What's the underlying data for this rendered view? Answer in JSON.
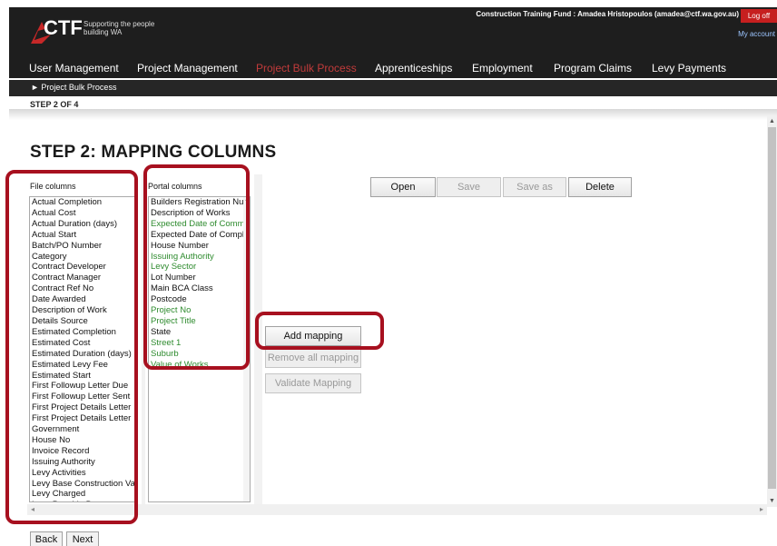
{
  "header": {
    "logo_text": "CTF",
    "tagline": "Supporting the people building WA",
    "user_line": "Construction Training Fund : Amadea Hristopoulos (amadea@ctf.wa.gov.au)",
    "logoff_label": "Log off",
    "my_account_label": "My account"
  },
  "nav": {
    "items": [
      {
        "label": "User Management"
      },
      {
        "label": "Project Management"
      },
      {
        "label": "Project Bulk Process",
        "active": true
      },
      {
        "label": "Apprenticeships"
      },
      {
        "label": "Employment"
      },
      {
        "label": "Program Claims"
      },
      {
        "label": "Levy Payments"
      }
    ]
  },
  "breadcrumb": "► Project Bulk Process",
  "step_indicator": "STEP 2 OF 4",
  "page_title": "STEP 2: MAPPING COLUMNS",
  "file_columns": {
    "label": "File columns",
    "items": [
      "Actual Completion",
      "Actual Cost",
      "Actual Duration (days)",
      "Actual Start",
      "Batch/PO Number",
      "Category",
      "Contract Developer",
      "Contract Manager",
      "Contract Ref No",
      "Date Awarded",
      "Description of Work",
      "Details Source",
      "Estimated Completion",
      "Estimated Cost",
      "Estimated Duration (days)",
      "Estimated Levy Fee",
      "Estimated Start",
      "First Followup Letter Due",
      "First Followup Letter Sent",
      "First Project Details Letter",
      "First Project Details Letter",
      "Government",
      "House No",
      "Invoice Record",
      "Issuing Authority",
      "Levy Activities",
      "Levy Base Construction Va",
      "Levy Charged",
      "Levy Payable By"
    ]
  },
  "portal_columns": {
    "label": "Portal columns",
    "items": [
      {
        "text": "Builders Registration Num",
        "required": false
      },
      {
        "text": "Description of Works",
        "required": false
      },
      {
        "text": "Expected Date of Commen",
        "required": true
      },
      {
        "text": "Expected Date of Complet",
        "required": false
      },
      {
        "text": "House Number",
        "required": false
      },
      {
        "text": "Issuing Authority",
        "required": true
      },
      {
        "text": "Levy Sector",
        "required": true
      },
      {
        "text": "Lot Number",
        "required": false
      },
      {
        "text": "Main BCA Class",
        "required": false
      },
      {
        "text": "Postcode",
        "required": false
      },
      {
        "text": "Project No",
        "required": true
      },
      {
        "text": "Project Title",
        "required": true
      },
      {
        "text": "State",
        "required": false
      },
      {
        "text": "Street 1",
        "required": true
      },
      {
        "text": "Suburb",
        "required": true
      },
      {
        "text": "Value of Works",
        "required": true
      }
    ]
  },
  "mapping_buttons": {
    "open": "Open",
    "save": "Save",
    "save_as": "Save as",
    "delete": "Delete"
  },
  "actions": {
    "add_mapping": "Add mapping",
    "remove_all": "Remove all mapping",
    "validate": "Validate Mapping"
  },
  "footer": {
    "back": "Back",
    "next": "Next"
  },
  "colors": {
    "highlight": "#a7101f",
    "active_nav": "#c23b3b",
    "required_field": "#2e8b2e",
    "logoff": "#c61f1f"
  }
}
